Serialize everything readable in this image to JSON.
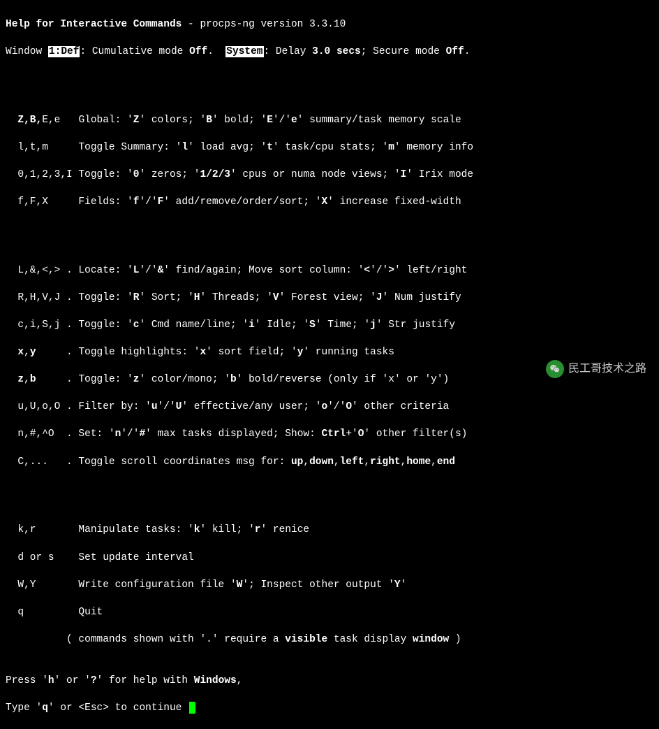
{
  "header": {
    "title_bold": "Help for Interactive Commands",
    "sep": " - ",
    "version": "procps-ng version 3.3.10"
  },
  "subheader": {
    "window_label": "Window ",
    "window_id_inv": "1:Def",
    "cumulative_prefix": ": Cumulative mode ",
    "cumulative_state": "Off",
    "dot1": ".  ",
    "system_inv": "System",
    "delay_prefix": ": Delay ",
    "delay_value": "3.0",
    "delay_unit": " secs",
    "secure_prefix": "; Secure mode ",
    "secure_state": "Off",
    "dot2": "."
  },
  "block1": {
    "r1": {
      "keys_b": "Z,B,",
      "keys_n": "E,e   ",
      "desc1": "Global: '",
      "k1": "Z",
      "desc2": "' colors; '",
      "k2": "B",
      "desc3": "' bold; '",
      "k3": "E",
      "desc4": "'/'",
      "k4": "e",
      "desc5": "' summary/task memory scale"
    },
    "r2": {
      "keys": "l,t,m     ",
      "desc1": "Toggle Summary: '",
      "k1": "l",
      "desc2": "' load avg; '",
      "k2": "t",
      "desc3": "' task/cpu stats; '",
      "k3": "m",
      "desc4": "' memory info"
    },
    "r3": {
      "keys": "0,1,2,3,I ",
      "desc1": "Toggle: '",
      "k1": "0",
      "desc2": "' zeros; '",
      "k2": "1/2/3",
      "desc3": "' cpus or numa node views; '",
      "k3": "I",
      "desc4": "' Irix mode"
    },
    "r4": {
      "keys": "f,F,X     ",
      "desc1": "Fields: '",
      "k1": "f",
      "desc2": "'/'",
      "k2": "F",
      "desc3": "' add/remove/order/sort; '",
      "k3": "X",
      "desc4": "' increase fixed-width"
    }
  },
  "block2": {
    "r1": {
      "keys": "L,&,<,> . ",
      "desc1": "Locate: '",
      "k1": "L",
      "desc2": "'/'",
      "k2": "&",
      "desc3": "' find/again; Move sort column: '",
      "k3": "<",
      "desc4": "'/'",
      "k4": ">",
      "desc5": "' left/right"
    },
    "r2": {
      "keys": "R,H,V,J . ",
      "desc1": "Toggle: '",
      "k1": "R",
      "desc2": "' Sort; '",
      "k2": "H",
      "desc3": "' Threads; '",
      "k3": "V",
      "desc4": "' Forest view; '",
      "k4": "J",
      "desc5": "' Num justify"
    },
    "r3": {
      "keys": "c,i,S,j . ",
      "desc1": "Toggle: '",
      "k1": "c",
      "desc2": "' Cmd name/line; '",
      "k2": "i",
      "desc3": "' Idle; '",
      "k3": "S",
      "desc4": "' Time; '",
      "k4": "j",
      "desc5": "' Str justify"
    },
    "r4": {
      "keys_b": "x",
      "keys_n": ",",
      "keys_b2": "y",
      "keys_pad": "     . ",
      "desc1": "Toggle highlights: '",
      "k1": "x",
      "desc2": "' sort field; '",
      "k2": "y",
      "desc3": "' running tasks"
    },
    "r5": {
      "keys_b": "z",
      "keys_n": ",",
      "keys_b2": "b",
      "keys_pad": "     . ",
      "desc1": "Toggle: '",
      "k1": "z",
      "desc2": "' color/mono; '",
      "k2": "b",
      "desc3": "' bold/reverse (only if 'x' or 'y')"
    },
    "r6": {
      "keys": "u,U,o,O . ",
      "desc1": "Filter by: '",
      "k1": "u",
      "desc2": "'/'",
      "k2": "U",
      "desc3": "' effective/any user; '",
      "k3": "o",
      "desc4": "'/'",
      "k4": "O",
      "desc5": "' other criteria"
    },
    "r7": {
      "keys": "n,#,^O  . ",
      "desc1": "Set: '",
      "k1": "n",
      "desc2": "'/'",
      "k2": "#",
      "desc3": "' max tasks displayed; Show: ",
      "k3": "Ctrl",
      "desc4": "+'",
      "k4": "O",
      "desc5": "' other filter(s)"
    },
    "r8": {
      "keys": "C,...   . ",
      "desc1": "Toggle scroll coordinates msg for: ",
      "b1": "up",
      "c1": ",",
      "b2": "down",
      "c2": ",",
      "b3": "left",
      "c3": ",",
      "b4": "right",
      "c4": ",",
      "b5": "home",
      "c5": ",",
      "b6": "end"
    }
  },
  "block3": {
    "r1": {
      "keys": "k,r       ",
      "desc1": "Manipulate tasks: '",
      "k1": "k",
      "desc2": "' kill; '",
      "k2": "r",
      "desc3": "' renice"
    },
    "r2": {
      "keys": "d or s    ",
      "desc": "Set update interval"
    },
    "r3": {
      "keys": "W,Y       ",
      "desc1": "Write configuration file '",
      "k1": "W",
      "desc2": "'; Inspect other output '",
      "k2": "Y",
      "desc3": "'"
    },
    "r4": {
      "keys": "q         ",
      "desc": "Quit"
    },
    "r5": {
      "pre": "          ( commands shown with '.' require a ",
      "b1": "visible",
      "mid": " task display ",
      "b2": "window",
      "post": " )"
    }
  },
  "footer": {
    "l1_pre": "Press '",
    "l1_k1": "h",
    "l1_mid": "' or '",
    "l1_k2": "?",
    "l1_post": "' for help with ",
    "l1_b": "Windows",
    "l1_end": ",",
    "l2_pre": "Type '",
    "l2_k1": "q",
    "l2_mid": "' or ",
    "l2_esc": "<Esc>",
    "l2_post": " to continue "
  },
  "watermark": "民工哥技术之路"
}
